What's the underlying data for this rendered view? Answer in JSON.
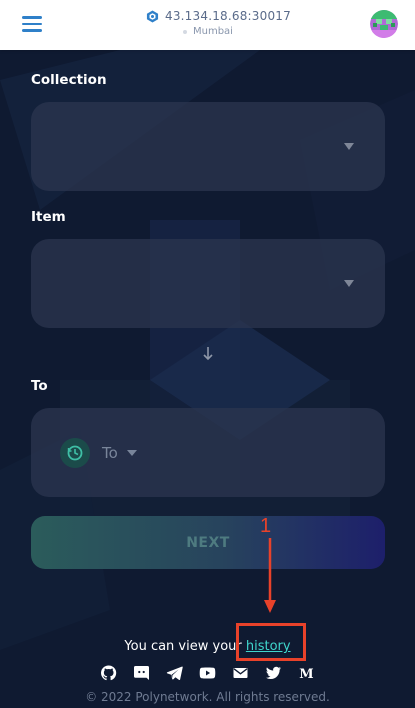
{
  "header": {
    "node_address": "43.134.18.68:30017",
    "network_name": "Mumbai"
  },
  "form": {
    "collection_label": "Collection",
    "collection_value": "",
    "item_label": "Item",
    "item_value": "",
    "to_label": "To",
    "to_selector_label": "To",
    "next_label": "NEXT"
  },
  "annotation": {
    "number": "1",
    "color": "#e8422a"
  },
  "footer": {
    "history_prefix": "You can view your",
    "history_link": "history",
    "socials": [
      "github-icon",
      "discord-icon",
      "telegram-icon",
      "youtube-icon",
      "mail-icon",
      "twitter-icon",
      "medium-icon"
    ],
    "copyright": "© 2022 Polynetwork. All rights reserved."
  },
  "colors": {
    "accent": "#3fd6cc",
    "background": "#0f1a31",
    "header_blue": "#2f80c9"
  }
}
